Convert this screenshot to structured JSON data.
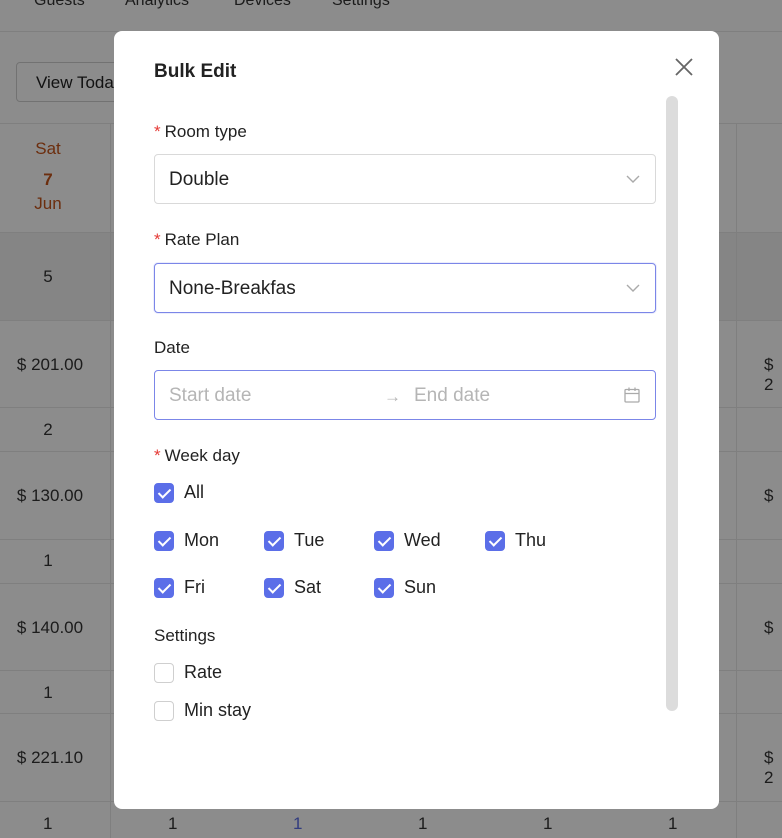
{
  "background": {
    "nav_items": [
      "Guests",
      "Analytics",
      "Devices",
      "Settings"
    ],
    "view_today_label": "View Toda",
    "day_header": {
      "weekday": "Sat",
      "day": "7",
      "month": "Jun"
    },
    "left_column": [
      "5",
      "$ 201.00",
      "2",
      "$ 130.00",
      "1",
      "$ 140.00",
      "1",
      "$ 221.10"
    ],
    "right_column": [
      "$ 2",
      "$",
      "$",
      "$ 2"
    ],
    "bottom_row": [
      "1",
      "1",
      "1",
      "1",
      "1",
      "1"
    ]
  },
  "modal": {
    "title": "Bulk Edit",
    "close_icon": "close-icon",
    "room_type": {
      "label": "Room type",
      "required_mark": "*",
      "value": "Double"
    },
    "rate_plan": {
      "label": "Rate Plan",
      "required_mark": "*",
      "value": "None-Breakfas"
    },
    "date": {
      "label": "Date",
      "start_placeholder": "Start date",
      "arrow": "→",
      "end_placeholder": "End date"
    },
    "week_day": {
      "label": "Week day",
      "required_mark": "*",
      "all": {
        "label": "All",
        "checked": true
      },
      "days": [
        {
          "label": "Mon",
          "checked": true
        },
        {
          "label": "Tue",
          "checked": true
        },
        {
          "label": "Wed",
          "checked": true
        },
        {
          "label": "Thu",
          "checked": true
        },
        {
          "label": "Fri",
          "checked": true
        },
        {
          "label": "Sat",
          "checked": true
        },
        {
          "label": "Sun",
          "checked": true
        }
      ]
    },
    "settings": {
      "label": "Settings",
      "options": [
        {
          "label": "Rate",
          "checked": false
        },
        {
          "label": "Min stay",
          "checked": false
        }
      ]
    }
  },
  "colors": {
    "accent": "#5b6ee8",
    "required": "#e53935",
    "weekend": "#c5541a"
  }
}
